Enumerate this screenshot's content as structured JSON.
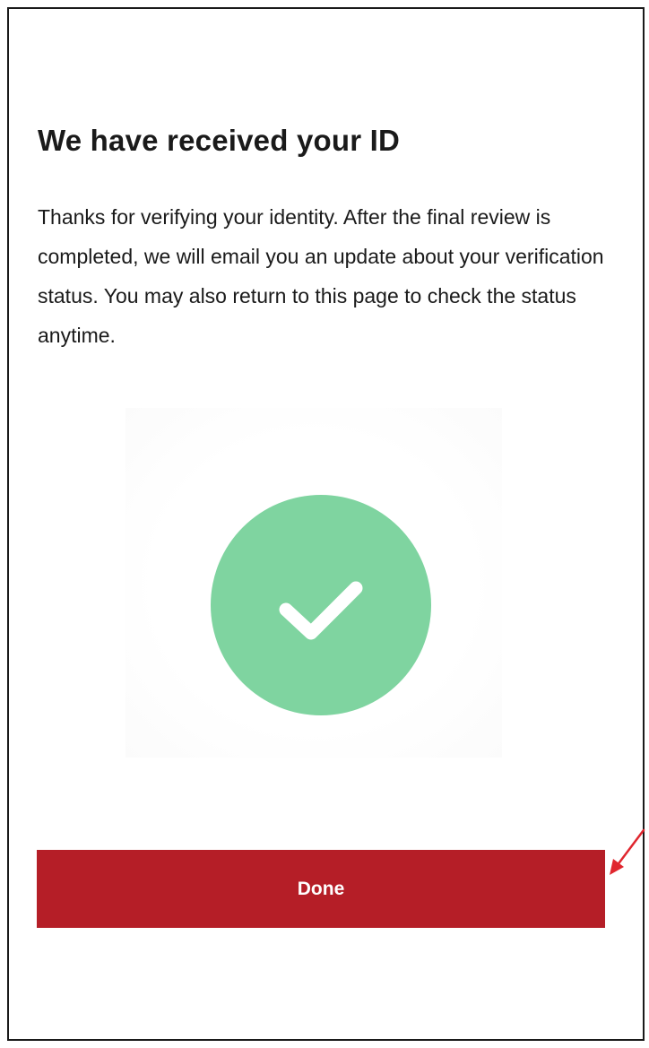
{
  "heading": "We have received your ID",
  "message": "Thanks for verifying your identity. After the final review is completed, we will email you an update about your verification status. You may also return to this page to check the status anytime.",
  "status_icon": "check-circle-icon",
  "colors": {
    "success_green": "#7fd4a0",
    "primary_red": "#b51e27",
    "annotation_arrow": "#e0262e"
  },
  "done_button": {
    "label": "Done"
  }
}
